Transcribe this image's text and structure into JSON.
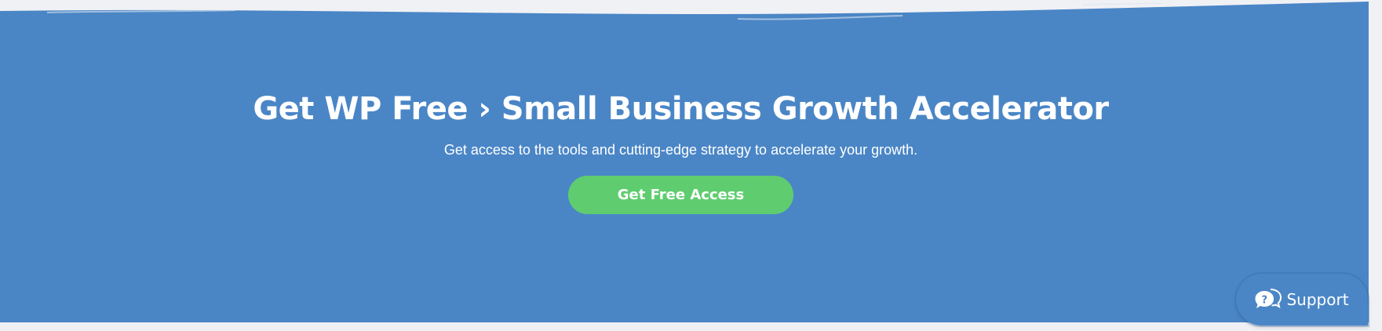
{
  "hero": {
    "title": "Get WP Free › Small Business Growth Accelerator",
    "subtitle": "Get access to the tools and cutting-edge strategy to accelerate your growth.",
    "cta_label": "Get Free Access"
  },
  "support_widget": {
    "label": "Support",
    "icon": "help-chat-icon"
  },
  "colors": {
    "band_background": "#4a86c6",
    "cta_background": "#5fcd6f",
    "page_background": "#f0f1f5",
    "text": "#ffffff"
  }
}
